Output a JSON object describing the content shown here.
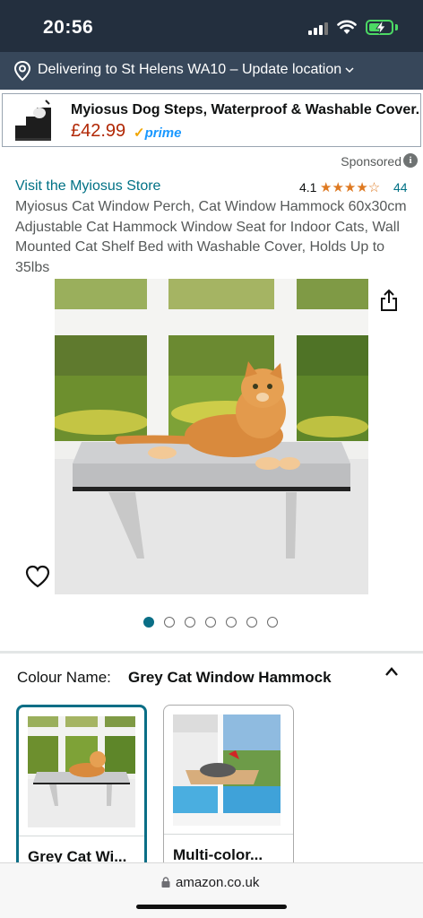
{
  "status": {
    "time": "20:56"
  },
  "delivery": {
    "text": "Delivering to St Helens WA10 – Update location",
    "icon": "location-pin-icon"
  },
  "ad": {
    "title": "Myiosus Dog Steps, Waterproof & Washable Cover...",
    "price": "£42.99",
    "prime": "prime",
    "prime_tick": "✓"
  },
  "sponsored": {
    "label": "Sponsored",
    "info": "i"
  },
  "product": {
    "store_link": "Visit the Myiosus Store",
    "rating": "4.1",
    "stars": "★★★★☆",
    "rating_count": "44",
    "title": "Myiosus Cat Window Perch, Cat Window Hammock 60x30cm Adjustable Cat Hammock Window Seat for Indoor Cats, Wall Mounted Cat Shelf Bed with Washable Cover, Holds Up to 35lbs",
    "image_count": 7,
    "active_image_index": 0
  },
  "colour": {
    "label": "Colour Name:",
    "value": "Grey Cat Window Hammock",
    "options": [
      {
        "label": "Grey Cat Wi...",
        "selected": true
      },
      {
        "label": "Multi-color...",
        "selected": false
      }
    ]
  },
  "browser": {
    "url": "amazon.co.uk"
  },
  "colors": {
    "header": "#232f3e",
    "delivery": "#37475a",
    "link": "#007185",
    "price": "#b12704",
    "star": "#de7921",
    "accent": "#0a6e86"
  }
}
